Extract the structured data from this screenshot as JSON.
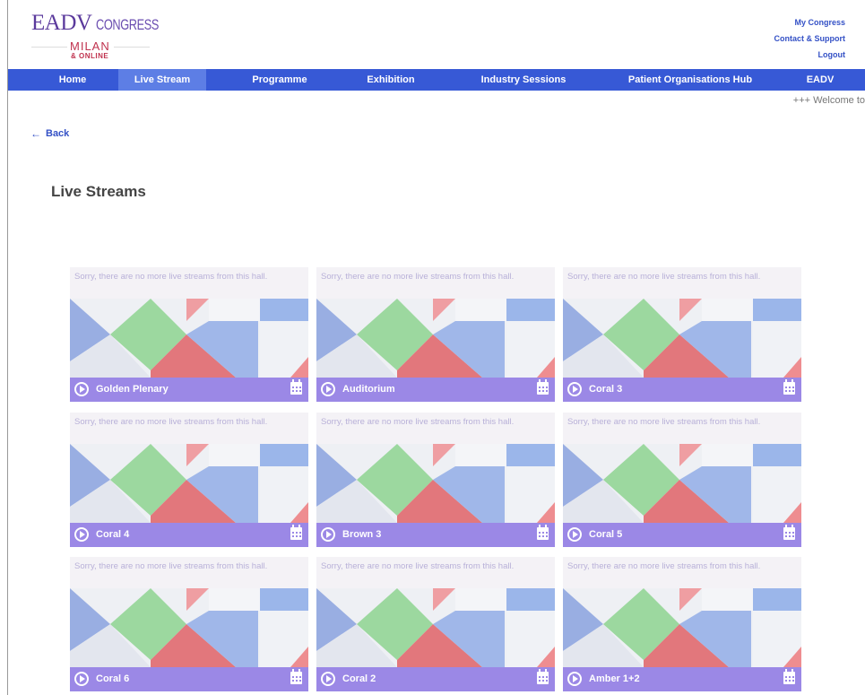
{
  "header": {
    "logo": {
      "eadv": "EADV",
      "congress": "CONGRESS",
      "milan": "MILAN",
      "online": "& ONLINE"
    },
    "links": [
      "My Congress",
      "Contact & Support",
      "Logout"
    ]
  },
  "nav": {
    "items": [
      "Home",
      "Live Stream",
      "Programme",
      "Exhibition",
      "Industry Sessions",
      "Patient Organisations Hub",
      "EADV"
    ],
    "active": "Live Stream"
  },
  "ticker": "+++ Welcome to",
  "back_label": "Back",
  "page_title": "Live Streams",
  "cards": [
    {
      "message": "Sorry, there are no more live streams from this hall.",
      "label": "Golden Plenary"
    },
    {
      "message": "Sorry, there are no more live streams from this hall.",
      "label": "Auditorium"
    },
    {
      "message": "Sorry, there are no more live streams from this hall.",
      "label": "Coral 3"
    },
    {
      "message": "Sorry, there are no more live streams from this hall.",
      "label": "Coral 4"
    },
    {
      "message": "Sorry, there are no more live streams from this hall.",
      "label": "Brown 3"
    },
    {
      "message": "Sorry, there are no more live streams from this hall.",
      "label": "Coral 5"
    },
    {
      "message": "Sorry, there are no more live streams from this hall.",
      "label": "Coral 6"
    },
    {
      "message": "Sorry, there are no more live streams from this hall.",
      "label": "Coral 2"
    },
    {
      "message": "Sorry, there are no more live streams from this hall.",
      "label": "Amber 1+2"
    }
  ],
  "colors": {
    "nav": "#3759d6",
    "nav_active": "#5d7ee5",
    "card_bar": "#9b88e6",
    "link": "#3451c6"
  }
}
